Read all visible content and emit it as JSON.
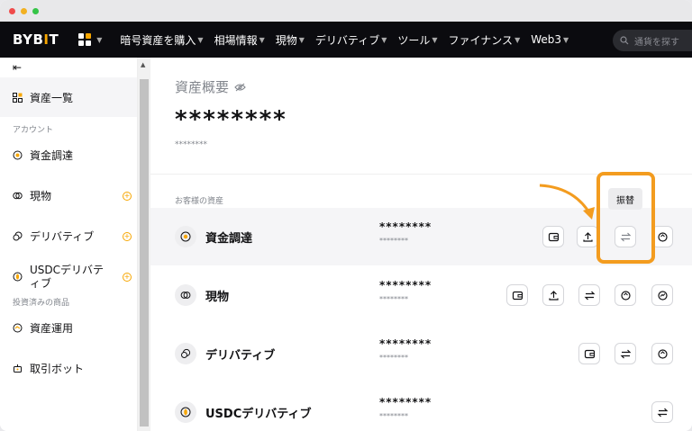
{
  "nav": {
    "logo": "BYBIT",
    "items": [
      {
        "label": "暗号資産を購入"
      },
      {
        "label": "相場情報"
      },
      {
        "label": "現物"
      },
      {
        "label": "デリバティブ"
      },
      {
        "label": "ツール"
      },
      {
        "label": "ファイナンス"
      },
      {
        "label": "Web3"
      }
    ],
    "search_placeholder": "通貨を探す"
  },
  "sidebar": {
    "collapse_icon": "menu-collapse-icon",
    "active": {
      "label": "資産一覧",
      "icon": "grid-icon"
    },
    "section_accounts": "アカウント",
    "accounts": [
      {
        "label": "資金調達",
        "icon": "funding-icon",
        "plus": false
      },
      {
        "label": "現物",
        "icon": "spot-icon",
        "plus": true
      },
      {
        "label": "デリバティブ",
        "icon": "derivatives-icon",
        "plus": true
      },
      {
        "label": "USDCデリバティブ",
        "icon": "usdc-icon",
        "plus": true
      }
    ],
    "section_invested": "投資済みの商品",
    "invested": [
      {
        "label": "資産運用",
        "icon": "earn-icon"
      },
      {
        "label": "取引ボット",
        "icon": "bot-icon"
      }
    ]
  },
  "main": {
    "title": "資産概要",
    "title_icon": "eye-off-icon",
    "balance_masked": "********",
    "balance_sub_masked": "********",
    "section_label": "お客様の資産",
    "rows": [
      {
        "name": "資金調達",
        "v1": "********",
        "v2": "********"
      },
      {
        "name": "現物",
        "v1": "********",
        "v2": "********"
      },
      {
        "name": "デリバティブ",
        "v1": "********",
        "v2": "********"
      },
      {
        "name": "USDCデリバティブ",
        "v1": "********",
        "v2": "********"
      }
    ],
    "tooltip": "振替"
  },
  "colors": {
    "accent": "#f7a600",
    "highlight": "#f39c1f",
    "nav_bg": "#0b0b0f"
  }
}
